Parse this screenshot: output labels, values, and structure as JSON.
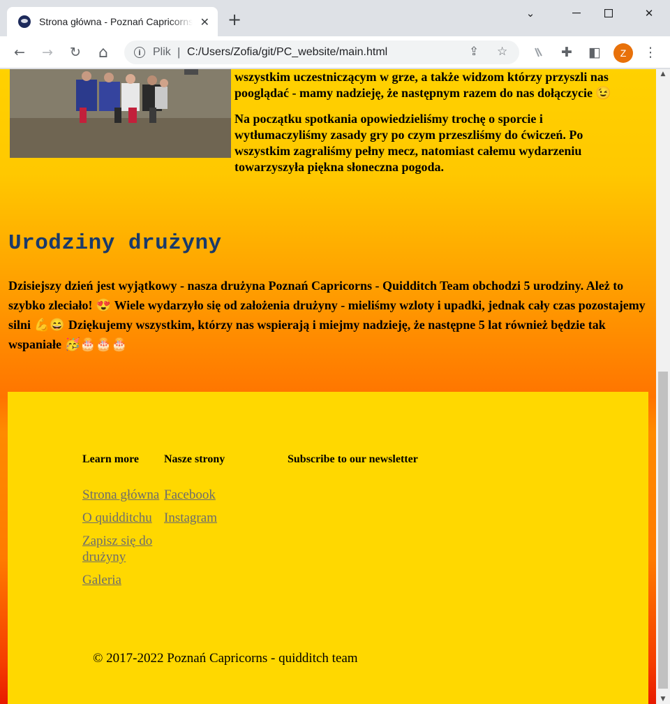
{
  "browser": {
    "tab_title": "Strona główna - Poznań Capricorns - Quidditch Team",
    "tab_close": "✕",
    "new_tab": "+",
    "minimize": "⌄",
    "restore": "☐",
    "close": "✕",
    "back": "←",
    "forward": "→",
    "reload": "↻",
    "home": "⌂",
    "info": "i",
    "scheme_label": "Plik",
    "separator": "|",
    "url": "C:/Users/Zofia/git/PC_website/main.html",
    "share": "⇪",
    "bookmark": "☆",
    "extensions": "✚",
    "sidebar": "◧",
    "menu": "⋮",
    "profile_initial": "Z"
  },
  "intro": {
    "paragraph1": "wszystkim uczestniczącym w grze, a także widzom którzy przyszli nas pooglądać - mamy nadzieję, że następnym razem do nas dołączycie 😉",
    "paragraph2": "Na początku spotkania opowiedzieliśmy trochę o sporcie i wytłumaczyliśmy zasady gry po czym przeszliśmy do ćwiczeń. Po wszystkim zagraliśmy pełny mecz, natomiast całemu wydarzeniu towarzyszyła piękna słoneczna pogoda."
  },
  "birthday": {
    "title": "Urodziny drużyny",
    "text": "Dzisiejszy dzień jest wyjątkowy - nasza drużyna Poznań Capricorns - Quidditch Team obchodzi 5 urodziny. Ależ to szybko zleciało! 😍 Wiele wydarzyło się od założenia drużyny - mieliśmy wzloty i upadki, jednak cały czas pozostajemy silni 💪😄 Dziękujemy wszystkim, którzy nas wspierają i miejmy nadzieję, że następne 5 lat również będzie tak wspaniałe 🥳🎂🎂🎂"
  },
  "footer": {
    "learn_more": {
      "heading": "Learn more",
      "links": [
        "Strona główna",
        "O quidditchu",
        "Zapisz się do drużyny",
        "Galeria"
      ]
    },
    "our_pages": {
      "heading": "Nasze strony",
      "links": [
        "Facebook",
        "Instagram"
      ]
    },
    "newsletter": {
      "heading": "Subscribe to our newsletter"
    },
    "copyright": "© 2017-2022 Poznań Capricorns - quidditch team"
  },
  "scrollbar": {
    "up": "▲",
    "down": "▼"
  }
}
